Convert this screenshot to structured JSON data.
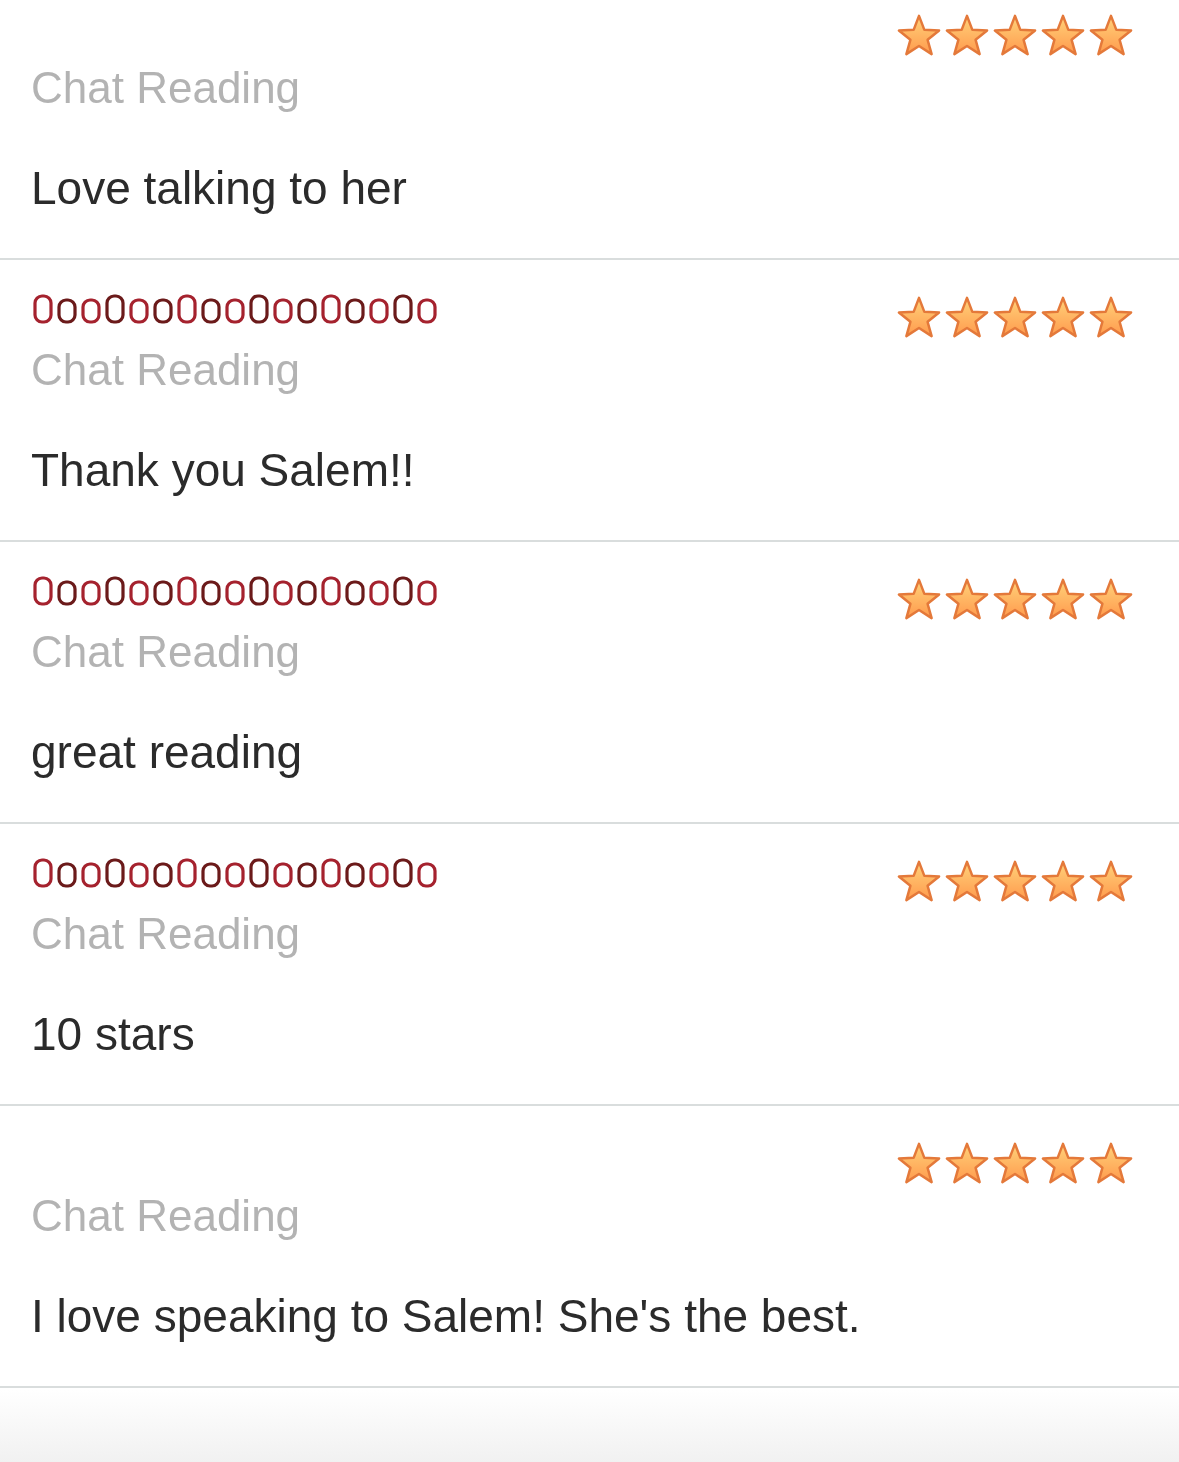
{
  "reviews": [
    {
      "name_obscured": false,
      "stars": 5,
      "reading_type": "Chat Reading",
      "text": "Love talking to her"
    },
    {
      "name_obscured": true,
      "stars": 5,
      "reading_type": "Chat Reading",
      "text": "Thank you Salem!!"
    },
    {
      "name_obscured": true,
      "stars": 5,
      "reading_type": "Chat Reading",
      "text": "great reading"
    },
    {
      "name_obscured": true,
      "stars": 5,
      "reading_type": "Chat Reading",
      "text": "10 stars"
    },
    {
      "name_obscured": false,
      "stars": 5,
      "reading_type": "Chat Reading",
      "text": "I love speaking to Salem! She's the best."
    }
  ]
}
